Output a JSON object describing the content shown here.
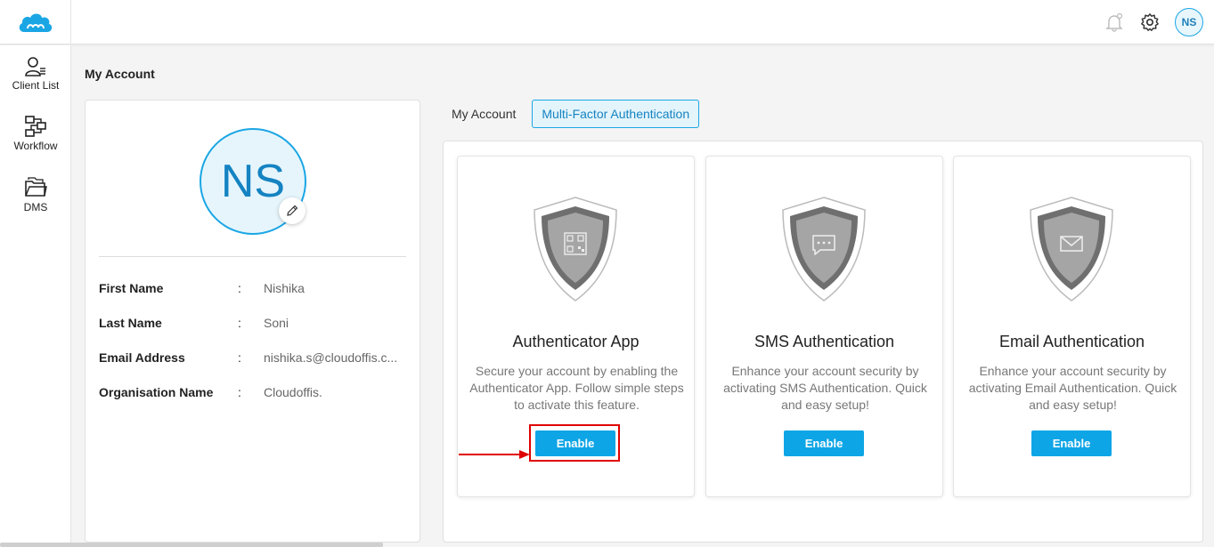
{
  "header": {
    "avatar_initials": "NS"
  },
  "sidebar": {
    "items": [
      {
        "label": "Client List",
        "icon": "client-list-icon"
      },
      {
        "label": "Workflow",
        "icon": "workflow-icon"
      },
      {
        "label": "DMS",
        "icon": "folder-icon"
      }
    ]
  },
  "page": {
    "title": "My Account"
  },
  "profile": {
    "initials": "NS",
    "fields": [
      {
        "key": "First Name",
        "value": "Nishika"
      },
      {
        "key": "Last Name",
        "value": "Soni"
      },
      {
        "key": "Email Address",
        "value": "nishika.s@cloudoffis.c..."
      },
      {
        "key": "Organisation Name",
        "value": "Cloudoffis."
      }
    ],
    "separator": ":"
  },
  "tabs": [
    {
      "label": "My Account",
      "active": false
    },
    {
      "label": "Multi-Factor Authentication",
      "active": true
    }
  ],
  "mfa_cards": [
    {
      "title": "Authenticator App",
      "description": "Secure your account by enabling the Authenticator App. Follow simple steps to activate this feature.",
      "button": "Enable",
      "icon": "qr-code-icon"
    },
    {
      "title": "SMS Authentication",
      "description": "Enhance your account security by activating SMS Authentication. Quick and easy setup!",
      "button": "Enable",
      "icon": "chat-icon"
    },
    {
      "title": "Email Authentication",
      "description": "Enhance your account security by activating Email Authentication. Quick and easy setup!",
      "button": "Enable",
      "icon": "envelope-icon"
    }
  ],
  "colors": {
    "accent": "#0ea5e6",
    "highlight": "#e00000"
  }
}
